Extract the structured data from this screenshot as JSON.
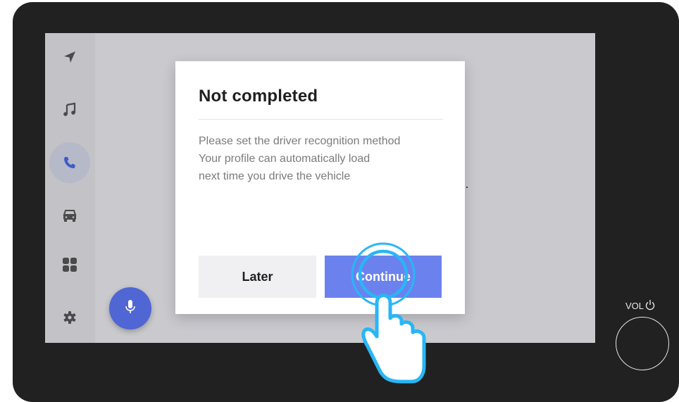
{
  "dialog": {
    "title": "Not completed",
    "message_lines": [
      "Please set the driver recognition method",
      "Your profile can automatically load",
      "next time you drive the vehicle"
    ],
    "later_label": "Later",
    "continue_label": "Continue"
  },
  "sidebar": {
    "items": [
      {
        "icon": "navigation-arrow-icon",
        "active": false
      },
      {
        "icon": "music-note-icon",
        "active": false
      },
      {
        "icon": "phone-icon",
        "active": true
      },
      {
        "icon": "car-icon",
        "active": false
      },
      {
        "icon": "apps-grid-icon",
        "active": false
      },
      {
        "icon": "settings-gear-icon",
        "active": false
      }
    ]
  },
  "voice_button": {
    "icon": "microphone-icon"
  },
  "hardware": {
    "volume_label": "VOL",
    "power_icon": "power-icon"
  },
  "colors": {
    "bezel": "#212121",
    "screen_background": "#c9c9ce",
    "sidebar_background": "#c2c2c7",
    "active_highlight": "#b5b9c8",
    "accent": "#6b82ee",
    "fab": "#4f66d4",
    "tap_highlight": "#29b6f6"
  }
}
